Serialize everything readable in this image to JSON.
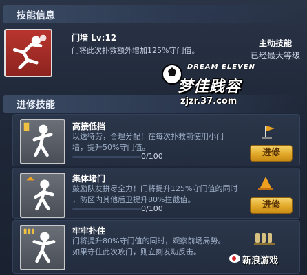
{
  "skill_info": {
    "header": "技能信息",
    "skill": {
      "name": "门墙 Lv:12",
      "desc": "门将此次扑救额外增加125%守门值。",
      "type_label": "主动技能",
      "status": "已经最大等级"
    }
  },
  "advanced": {
    "header": "进修技能",
    "items": [
      {
        "name": "高接低挡",
        "desc_line1": "以逸待劳，合理分配！在每次扑救前使用小门",
        "desc_line2": "墙，提升50%守门值。",
        "progress": "0/100",
        "button": "进修",
        "icon": "training-flag-icon"
      },
      {
        "name": "集体堵门",
        "desc_line1": "鼓励队友拼尽全力！门将提升125%守门值的同时",
        "desc_line2": "，防区内其他后卫提升80%拦截值。",
        "progress": "0/100",
        "button": "进修",
        "icon": "training-cone-icon"
      },
      {
        "name": "牢牢扑住",
        "desc_line1": "门将提升80%守门值的同时，观察前场局势。",
        "desc_line2": "如果守住此次攻门，则立刻发动反击。",
        "progress": "0/100",
        "icon": "training-dummies-icon"
      }
    ]
  },
  "watermark": {
    "brand_en": "DREAM ELEVEN",
    "brand_cn": "梦佳践容",
    "url": "zjzr.37.com",
    "sina": "新浪游戏"
  }
}
